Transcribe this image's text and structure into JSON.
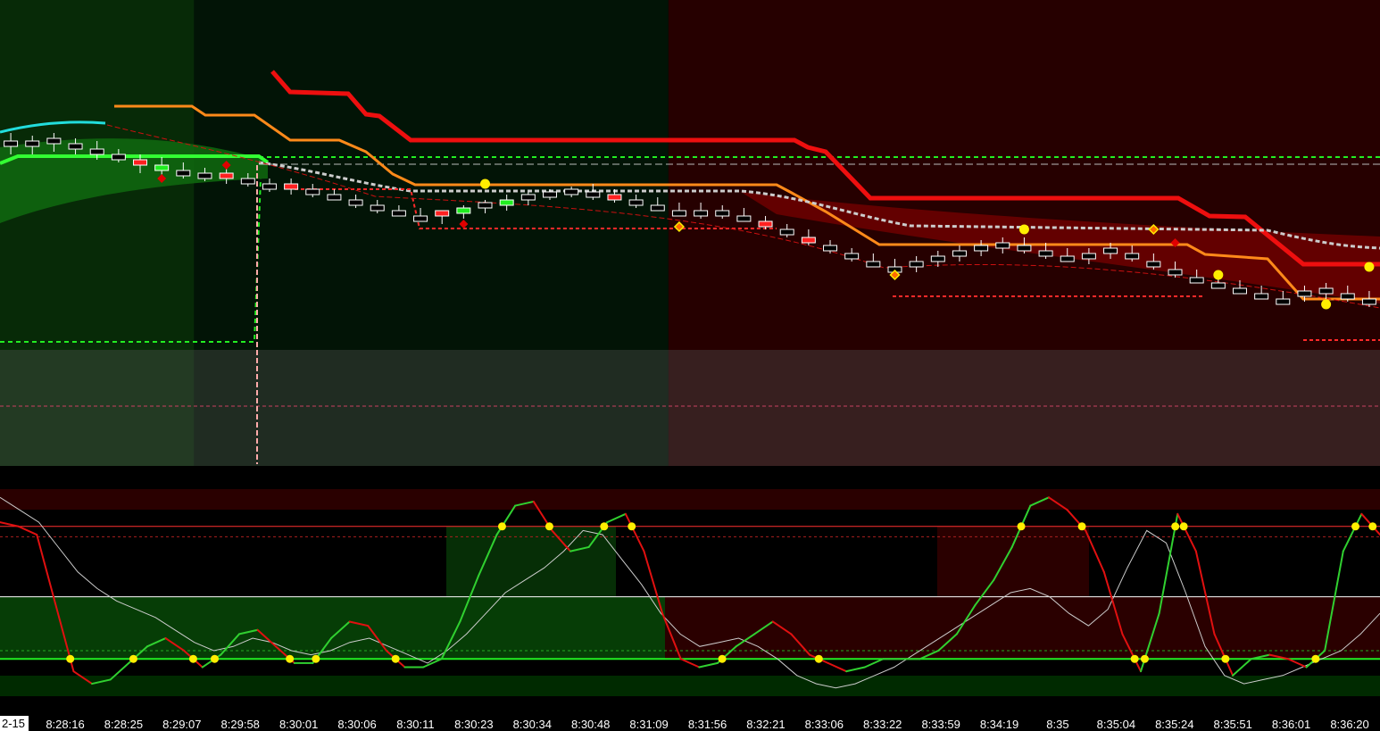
{
  "chart_data": [
    {
      "type": "candlestick",
      "title": "",
      "date_tag": "2-15",
      "time_labels": [
        "8:28:16",
        "8:28:25",
        "8:29:07",
        "8:29:58",
        "8:30:01",
        "8:30:06",
        "8:30:11",
        "8:30:23",
        "8:30:34",
        "8:30:48",
        "8:31:09",
        "8:31:56",
        "8:32:21",
        "8:33:06",
        "8:33:22",
        "8:33:59",
        "8:34:19",
        "8:35",
        "8:35:04",
        "8:35:24",
        "8:35:51",
        "8:36:01",
        "8:36:20"
      ],
      "background_zones": [
        {
          "from_bar": 0,
          "to_bar": 9,
          "color": "#072a07"
        },
        {
          "from_bar": 9,
          "to_bar": 31,
          "color": "#021406"
        },
        {
          "from_bar": 31,
          "to_bar": 64,
          "color": "#260000"
        }
      ],
      "price_axis_range": [
        0,
        100
      ],
      "candles": [
        {
          "o": 21,
          "h": 18,
          "l": 26,
          "c": 23
        },
        {
          "o": 22,
          "h": 19,
          "l": 26,
          "c": 21
        },
        {
          "o": 21,
          "h": 18,
          "l": 25,
          "c": 20
        },
        {
          "o": 22,
          "h": 20,
          "l": 26,
          "c": 24
        },
        {
          "o": 24,
          "h": 21,
          "l": 28,
          "c": 26
        },
        {
          "o": 26,
          "h": 24,
          "l": 29,
          "c": 27
        },
        {
          "o": 30,
          "h": 26,
          "l": 33,
          "c": 28,
          "fill": "red"
        },
        {
          "o": 31,
          "h": 27,
          "l": 34,
          "c": 30,
          "fill": "green"
        },
        {
          "o": 32,
          "h": 29,
          "l": 35,
          "c": 33
        },
        {
          "o": 33,
          "h": 31,
          "l": 36,
          "c": 34
        },
        {
          "o": 35,
          "h": 31,
          "l": 37,
          "c": 33,
          "fill": "red"
        },
        {
          "o": 35,
          "h": 33,
          "l": 38,
          "c": 36
        },
        {
          "o": 37,
          "h": 35,
          "l": 40,
          "c": 38
        },
        {
          "o": 39,
          "h": 35,
          "l": 41,
          "c": 37,
          "fill": "red"
        },
        {
          "o": 39,
          "h": 37,
          "l": 42,
          "c": 40
        },
        {
          "o": 41,
          "h": 39,
          "l": 43,
          "c": 42
        },
        {
          "o": 43,
          "h": 41,
          "l": 46,
          "c": 44
        },
        {
          "o": 45,
          "h": 43,
          "l": 48,
          "c": 46
        },
        {
          "o": 47,
          "h": 45,
          "l": 49,
          "c": 48
        },
        {
          "o": 49,
          "h": 46,
          "l": 51,
          "c": 50
        },
        {
          "o": 49,
          "h": 47,
          "l": 52,
          "c": 47,
          "fill": "red"
        },
        {
          "o": 48,
          "h": 45,
          "l": 50,
          "c": 46,
          "fill": "green"
        },
        {
          "o": 46,
          "h": 43,
          "l": 48,
          "c": 44
        },
        {
          "o": 44,
          "h": 41,
          "l": 47,
          "c": 43,
          "fill": "green"
        },
        {
          "o": 43,
          "h": 40,
          "l": 45,
          "c": 41
        },
        {
          "o": 41,
          "h": 39,
          "l": 43,
          "c": 40
        },
        {
          "o": 40,
          "h": 38,
          "l": 42,
          "c": 39
        },
        {
          "o": 40,
          "h": 37,
          "l": 43,
          "c": 41
        },
        {
          "o": 41,
          "h": 39,
          "l": 44,
          "c": 43,
          "fill": "red"
        },
        {
          "o": 43,
          "h": 41,
          "l": 46,
          "c": 44
        },
        {
          "o": 45,
          "h": 42,
          "l": 47,
          "c": 46
        },
        {
          "o": 47,
          "h": 44,
          "l": 49,
          "c": 48
        },
        {
          "o": 47,
          "h": 44,
          "l": 50,
          "c": 48
        },
        {
          "o": 48,
          "h": 45,
          "l": 50,
          "c": 47
        },
        {
          "o": 49,
          "h": 46,
          "l": 51,
          "c": 50
        },
        {
          "o": 51,
          "h": 49,
          "l": 54,
          "c": 53,
          "fill": "red"
        },
        {
          "o": 54,
          "h": 52,
          "l": 57,
          "c": 56
        },
        {
          "o": 57,
          "h": 54,
          "l": 60,
          "c": 59,
          "fill": "red"
        },
        {
          "o": 60,
          "h": 58,
          "l": 63,
          "c": 62
        },
        {
          "o": 63,
          "h": 61,
          "l": 66,
          "c": 65
        },
        {
          "o": 66,
          "h": 63,
          "l": 68,
          "c": 67
        },
        {
          "o": 68,
          "h": 65,
          "l": 70,
          "c": 69
        },
        {
          "o": 68,
          "h": 64,
          "l": 70,
          "c": 66
        },
        {
          "o": 66,
          "h": 62,
          "l": 68,
          "c": 64
        },
        {
          "o": 64,
          "h": 60,
          "l": 66,
          "c": 62
        },
        {
          "o": 62,
          "h": 58,
          "l": 64,
          "c": 60
        },
        {
          "o": 61,
          "h": 57,
          "l": 63,
          "c": 59
        },
        {
          "o": 60,
          "h": 57,
          "l": 63,
          "c": 61
        },
        {
          "o": 62,
          "h": 59,
          "l": 65,
          "c": 63
        },
        {
          "o": 64,
          "h": 61,
          "l": 66,
          "c": 65
        },
        {
          "o": 64,
          "h": 61,
          "l": 67,
          "c": 63
        },
        {
          "o": 62,
          "h": 59,
          "l": 65,
          "c": 61
        },
        {
          "o": 63,
          "h": 60,
          "l": 66,
          "c": 65
        },
        {
          "o": 66,
          "h": 63,
          "l": 69,
          "c": 68
        },
        {
          "o": 69,
          "h": 66,
          "l": 72,
          "c": 71
        },
        {
          "o": 72,
          "h": 69,
          "l": 74,
          "c": 73
        },
        {
          "o": 74,
          "h": 71,
          "l": 76,
          "c": 75
        },
        {
          "o": 76,
          "h": 73,
          "l": 78,
          "c": 77
        },
        {
          "o": 78,
          "h": 75,
          "l": 80,
          "c": 79
        },
        {
          "o": 80,
          "h": 77,
          "l": 82,
          "c": 81
        },
        {
          "o": 79,
          "h": 75,
          "l": 81,
          "c": 77
        },
        {
          "o": 77,
          "h": 74,
          "l": 80,
          "c": 76
        },
        {
          "o": 78,
          "h": 75,
          "l": 81,
          "c": 80
        },
        {
          "o": 80,
          "h": 77,
          "l": 83,
          "c": 82
        }
      ],
      "markers": [
        {
          "bar": 7,
          "price": 35,
          "shape": "diamond",
          "color": "#e00000"
        },
        {
          "bar": 10,
          "price": 30,
          "shape": "diamond",
          "color": "#e00000"
        },
        {
          "bar": 21,
          "price": 52,
          "shape": "diamond",
          "color": "#e00000"
        },
        {
          "bar": 22,
          "price": 37,
          "shape": "circle",
          "color": "#ffee00"
        },
        {
          "bar": 31,
          "price": 53,
          "shape": "diamond",
          "color": "#ff6a00"
        },
        {
          "bar": 41,
          "price": 71,
          "shape": "diamond",
          "color": "#ff6a00"
        },
        {
          "bar": 47,
          "price": 54,
          "shape": "circle",
          "color": "#ffee00"
        },
        {
          "bar": 53,
          "price": 54,
          "shape": "diamond",
          "color": "#ff6a00"
        },
        {
          "bar": 54,
          "price": 59,
          "shape": "diamond",
          "color": "#e00000"
        },
        {
          "bar": 56,
          "price": 71,
          "shape": "circle",
          "color": "#ffee00"
        },
        {
          "bar": 61,
          "price": 82,
          "shape": "circle",
          "color": "#ffee00"
        },
        {
          "bar": 63,
          "price": 68,
          "shape": "circle",
          "color": "#ffee00"
        }
      ]
    },
    {
      "type": "line",
      "title": "",
      "y_range": [
        0,
        100
      ],
      "levels": {
        "upper": 82,
        "upper_dotted": 77,
        "middle": 48,
        "lower_dotted": 22,
        "lower": 18
      },
      "series": [
        {
          "color_rising": "#30d030",
          "color_falling": "#e01010",
          "values": [
            84,
            82,
            78,
            45,
            12,
            6,
            8,
            16,
            24,
            28,
            22,
            14,
            20,
            30,
            32,
            24,
            16,
            16,
            28,
            36,
            34,
            22,
            14,
            14,
            18,
            36,
            58,
            78,
            92,
            94,
            80,
            70,
            72,
            84,
            88,
            70,
            40,
            18,
            14,
            16,
            24,
            30,
            36,
            30,
            20,
            16,
            12,
            14,
            18,
            18,
            18,
            22,
            30,
            44,
            56,
            72,
            92,
            96,
            90,
            80,
            60,
            30,
            12,
            40,
            88,
            70,
            30,
            10,
            18,
            20,
            18,
            14,
            22,
            70,
            88,
            78
          ]
        },
        {
          "color": "#cccccc",
          "values": [
            96,
            90,
            84,
            72,
            60,
            52,
            46,
            42,
            38,
            32,
            26,
            22,
            24,
            28,
            26,
            22,
            20,
            22,
            26,
            28,
            24,
            20,
            16,
            22,
            30,
            40,
            50,
            56,
            62,
            70,
            80,
            78,
            66,
            54,
            40,
            30,
            24,
            26,
            28,
            24,
            18,
            10,
            6,
            4,
            6,
            10,
            14,
            20,
            26,
            32,
            38,
            44,
            50,
            52,
            48,
            40,
            34,
            42,
            62,
            80,
            74,
            50,
            24,
            10,
            6,
            8,
            10,
            14,
            18,
            22,
            30,
            40
          ]
        }
      ]
    }
  ]
}
